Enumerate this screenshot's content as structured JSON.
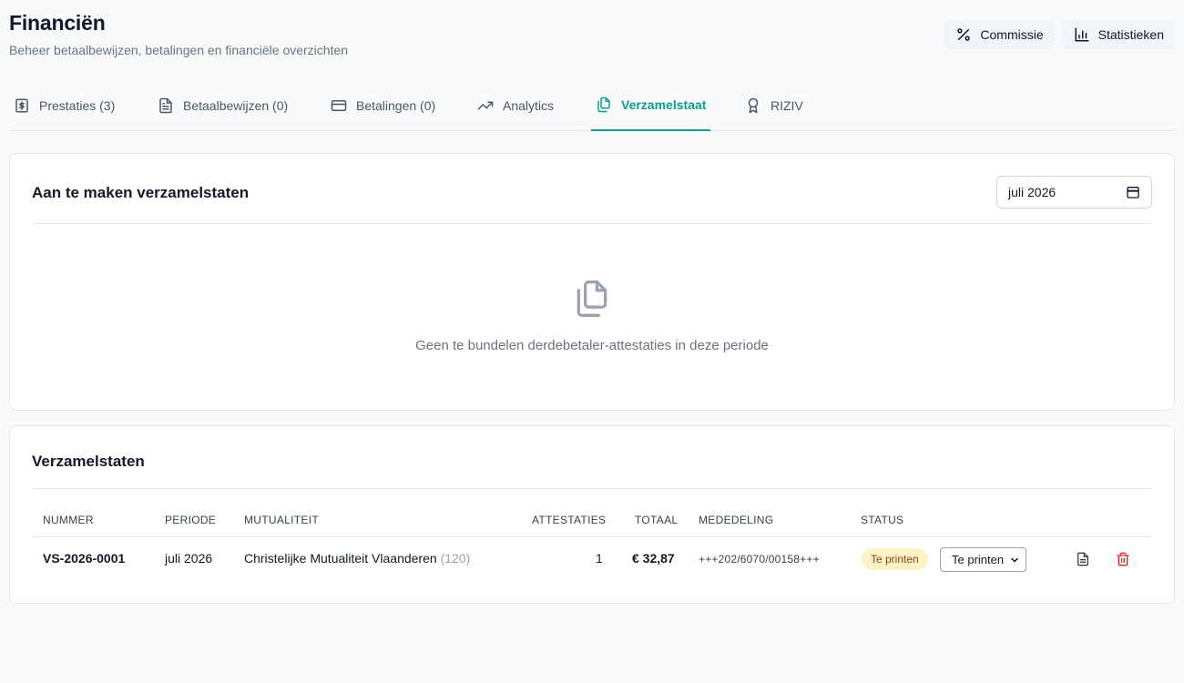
{
  "header": {
    "title": "Financiën",
    "subtitle": "Beheer betaalbewijzen, betalingen en financiële overzichten",
    "commission_label": "Commissie",
    "statistics_label": "Statistieken"
  },
  "tabs": [
    {
      "label": "Prestaties (3)",
      "icon": "dollar-document-icon"
    },
    {
      "label": "Betaalbewijzen (0)",
      "icon": "document-icon"
    },
    {
      "label": "Betalingen (0)",
      "icon": "credit-card-icon"
    },
    {
      "label": "Analytics",
      "icon": "trending-up-icon"
    },
    {
      "label": "Verzamelstaat",
      "icon": "copy-documents-icon",
      "active": true
    },
    {
      "label": "RIZIV",
      "icon": "award-icon"
    }
  ],
  "to_create": {
    "title": "Aan te maken verzamelstaten",
    "period_value": "juli 2026",
    "empty_message": "Geen te bundelen derdebetaler-attestaties in deze periode"
  },
  "statements": {
    "title": "Verzamelstaten",
    "columns": {
      "nummer": "NUMMER",
      "periode": "PERIODE",
      "mutualiteit": "MUTUALITEIT",
      "attestaties": "ATTESTATIES",
      "totaal": "TOTAAL",
      "mededeling": "MEDEDELING",
      "status": "STATUS"
    },
    "rows": [
      {
        "nummer": "VS-2026-0001",
        "periode": "juli 2026",
        "mutualiteit": "Christelijke Mutualiteit Vlaanderen",
        "mutualiteit_code": "(120)",
        "attestaties": "1",
        "totaal": "€ 32,87",
        "mededeling": "+++202/6070/00158+++",
        "status_badge": "Te printen",
        "status_select": "Te printen"
      }
    ]
  },
  "colors": {
    "accent": "#0f9f8a",
    "badge_bg": "#fef3c7",
    "badge_text": "#92400e",
    "delete": "#dc2626"
  }
}
